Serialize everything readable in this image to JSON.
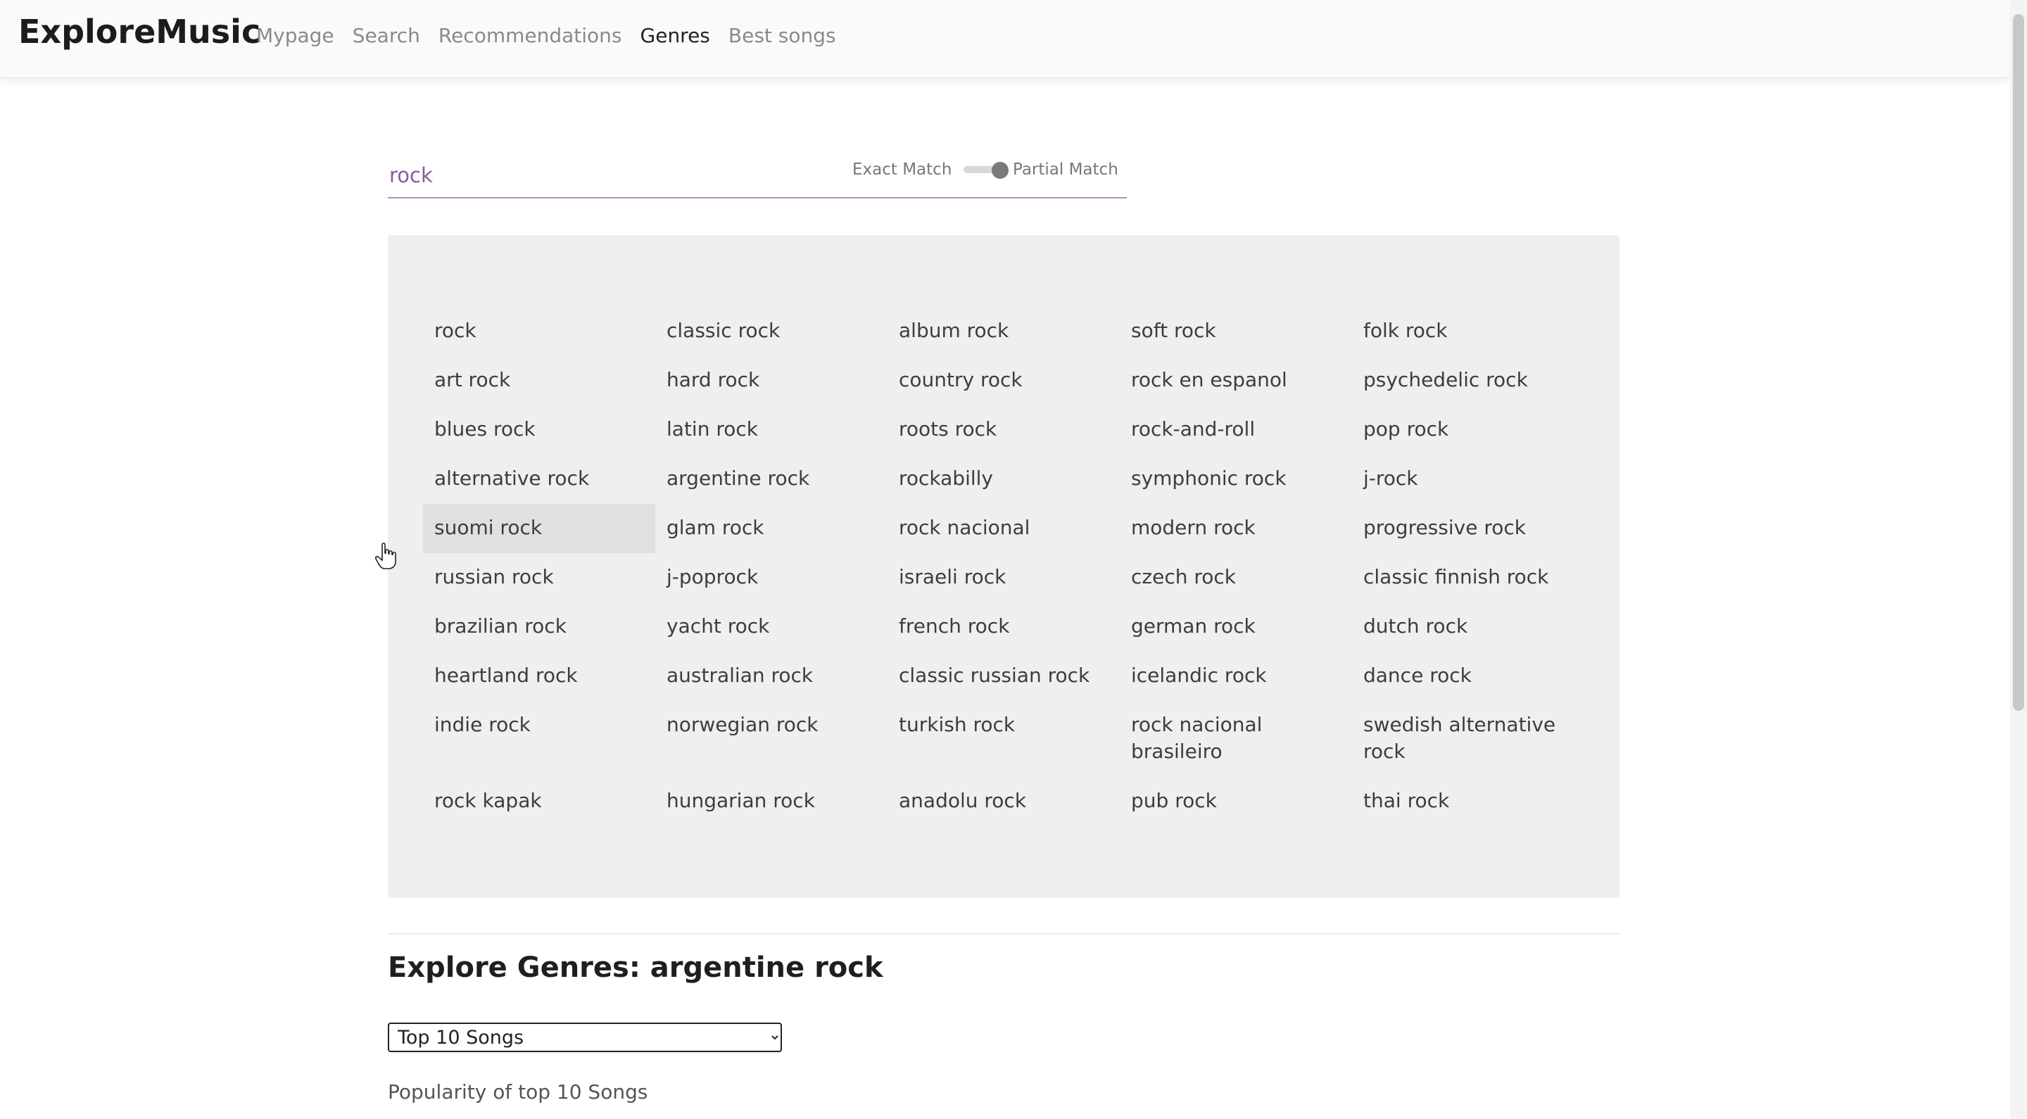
{
  "app": {
    "brand": "ExploreMusic"
  },
  "nav": {
    "items": [
      {
        "label": "Mypage"
      },
      {
        "label": "Search"
      },
      {
        "label": "Recommendations"
      },
      {
        "label": "Genres"
      },
      {
        "label": "Best songs"
      }
    ],
    "active": "Genres"
  },
  "search": {
    "value": "rock",
    "exact_label": "Exact Match",
    "partial_label": "Partial Match",
    "mode": "Partial Match"
  },
  "genres": [
    "rock",
    "classic rock",
    "album rock",
    "soft rock",
    "folk rock",
    "art rock",
    "hard rock",
    "country rock",
    "rock en espanol",
    "psychedelic rock",
    "blues rock",
    "latin rock",
    "roots rock",
    "rock-and-roll",
    "pop rock",
    "alternative rock",
    "argentine rock",
    "rockabilly",
    "symphonic rock",
    "j-rock",
    "suomi rock",
    "glam rock",
    "rock nacional",
    "modern rock",
    "progressive rock",
    "russian rock",
    "j-poprock",
    "israeli rock",
    "czech rock",
    "classic finnish rock",
    "brazilian rock",
    "yacht rock",
    "french rock",
    "german rock",
    "dutch rock",
    "heartland rock",
    "australian rock",
    "classic russian rock",
    "icelandic rock",
    "dance rock",
    "indie rock",
    "norwegian rock",
    "turkish rock",
    "rock nacional brasileiro",
    "swedish alternative rock",
    "rock kapak",
    "hungarian rock",
    "anadolu rock",
    "pub rock",
    "thai rock"
  ],
  "hovered_genre": "suomi rock",
  "explore": {
    "title": "Explore Genres: argentine rock",
    "select_options": [
      "Top 10 Songs"
    ],
    "selected": "Top 10 Songs",
    "subheading": "Popularity of top 10 Songs"
  }
}
